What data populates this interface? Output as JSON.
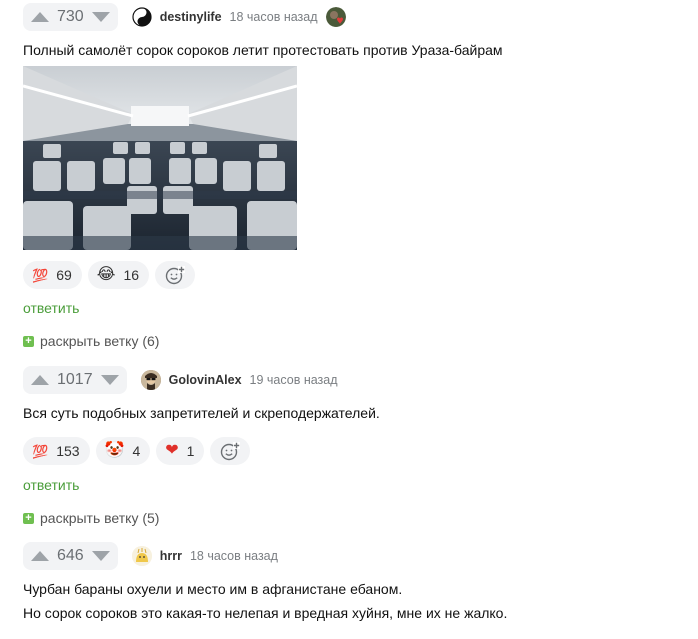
{
  "comments": [
    {
      "rating": "730",
      "author": "destinylife",
      "time": "18 часов назад",
      "text_lines": [
        "Полный самолёт сорок сороков летит протестовать против Ураза-байрам"
      ],
      "reactions": [
        {
          "icon": "hundred-points-icon",
          "glyph": "💯",
          "count": "69"
        },
        {
          "icon": "laughing-face-icon",
          "glyph": "😂",
          "count": "16"
        }
      ],
      "reply_label": "ответить",
      "expand_label": "раскрыть ветку (6)"
    },
    {
      "rating": "1017",
      "author": "GolovinAlex",
      "time": "19 часов назад",
      "text_lines": [
        "Вся суть подобных запретителей и скреподержателей."
      ],
      "reactions": [
        {
          "icon": "hundred-points-icon",
          "glyph": "💯",
          "count": "153"
        },
        {
          "icon": "clown-face-icon",
          "glyph": "🤡",
          "count": "4"
        },
        {
          "icon": "heart-icon",
          "glyph": "❤",
          "count": "1"
        }
      ],
      "reply_label": "ответить",
      "expand_label": "раскрыть ветку (5)"
    },
    {
      "rating": "646",
      "author": "hrrr",
      "time": "18 часов назад",
      "text_lines": [
        "Чурбан бараны охуели и место им в афганистане ебаном.",
        "Но сорок сороков это какая-то нелепая и вредная хуйня, мне их не жалко."
      ]
    }
  ],
  "colors": {
    "accent_green": "#4a9d3a",
    "expand_green": "#6fbf50",
    "pill_bg": "#f2f3f5"
  }
}
